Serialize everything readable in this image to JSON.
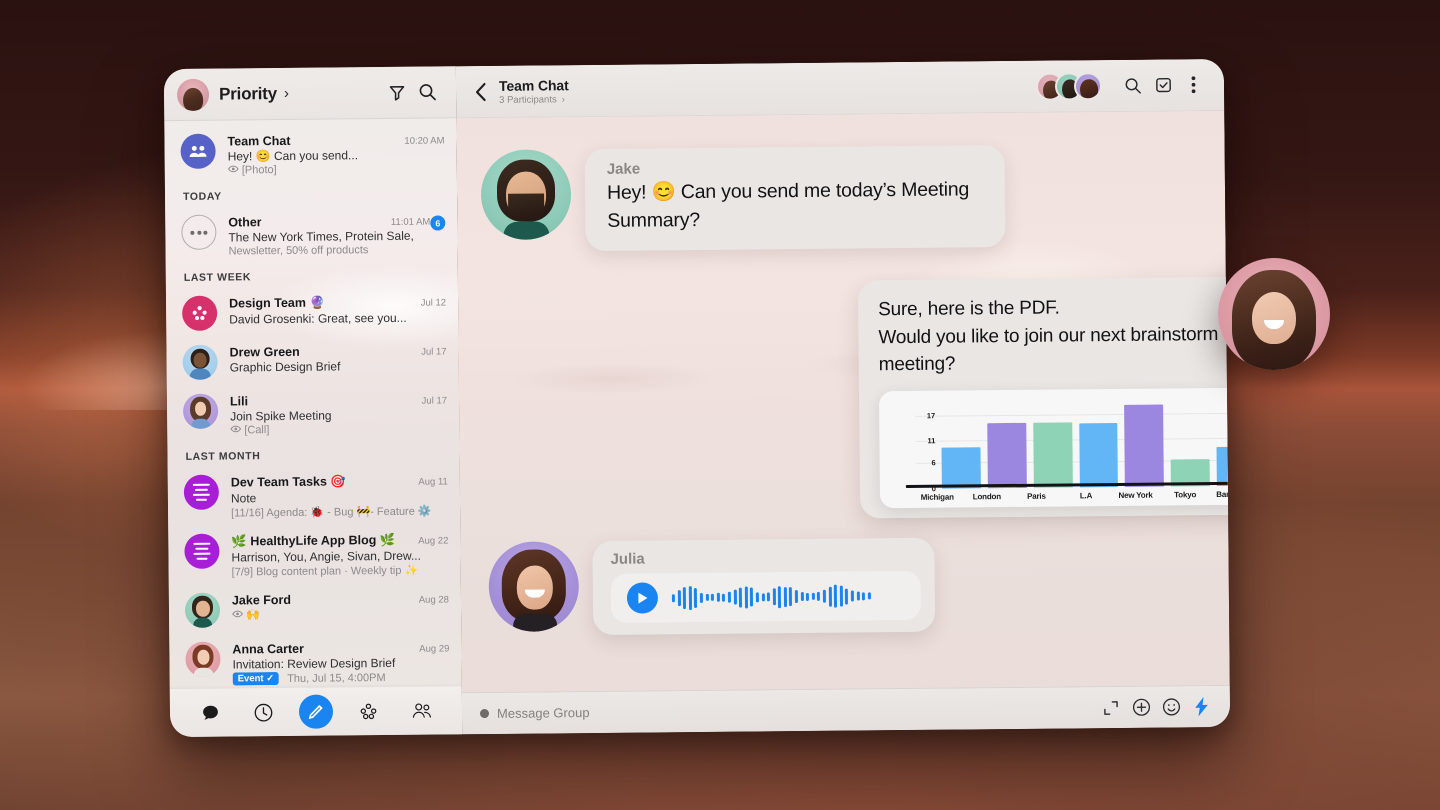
{
  "sidebar": {
    "header": {
      "title": "Priority",
      "chevron": "›",
      "filter_icon": "filter-icon",
      "search_icon": "search-icon"
    },
    "sections": [
      {
        "label": "",
        "items": [
          {
            "title": "Team Chat",
            "time": "10:20 AM",
            "sub": "Hey! 😊 Can you send...",
            "sub2": "[Photo]",
            "sub2_icon": "eye-icon",
            "avatar": "group-icon",
            "badge": ""
          }
        ]
      },
      {
        "label": "TODAY",
        "items": [
          {
            "title": "Other",
            "time": "11:01 AM",
            "sub": "The New York Times, Protein Sale,",
            "sub2": "Newsletter, 50% off products",
            "avatar": "ellipsis-icon",
            "badge": "6"
          }
        ]
      },
      {
        "label": "LAST WEEK",
        "items": [
          {
            "title": "Design Team 🔮",
            "time": "Jul 12",
            "sub": "David Grosenki: Great, see you...",
            "sub2": "",
            "avatar": "dots-cluster-icon",
            "badge": ""
          },
          {
            "title": "Drew Green",
            "time": "Jul 17",
            "sub": "Graphic Design Brief",
            "sub2": "",
            "avatar": "photo-drew",
            "badge": ""
          },
          {
            "title": "Lili",
            "time": "Jul 17",
            "sub": "Join Spike Meeting",
            "sub2": "[Call]",
            "sub2_icon": "eye-icon",
            "avatar": "photo-lili",
            "badge": ""
          }
        ]
      },
      {
        "label": "LAST MONTH",
        "items": [
          {
            "title": "Dev Team Tasks 🎯",
            "time": "Aug 11",
            "sub": "Note",
            "sub2": "[11/16] Agenda:  🐞 - Bug 🚧- Feature ⚙️",
            "avatar": "note-icon",
            "badge": ""
          },
          {
            "title": "🌿 HealthyLife App Blog 🌿",
            "time": "Aug 22",
            "sub": "Harrison, You, Angie, Sivan, Drew...",
            "sub2": "[7/9] Blog content plan · Weekly tip ✨",
            "avatar": "note-icon",
            "badge": ""
          },
          {
            "title": "Jake Ford",
            "time": "Aug 28",
            "sub2": "🙌",
            "sub": "",
            "sub2_icon": "eye-icon",
            "avatar": "photo-jake",
            "badge": ""
          },
          {
            "title": "Anna Carter",
            "time": "Aug 29",
            "sub": "Invitation: Review Design Brief",
            "chip": "Event ✓",
            "sub2": "Thu, Jul 15, 4:00PM",
            "avatar": "photo-anna",
            "badge": ""
          }
        ]
      }
    ],
    "nav": [
      {
        "name": "chats",
        "icon": "chat-bubble-icon",
        "active": true
      },
      {
        "name": "recent",
        "icon": "clock-icon",
        "active": false
      },
      {
        "name": "compose",
        "icon": "pencil-icon",
        "active": false
      },
      {
        "name": "groups",
        "icon": "dots-cluster-icon",
        "active": false
      },
      {
        "name": "contacts",
        "icon": "people-icon",
        "active": false
      }
    ]
  },
  "chat": {
    "back_icon": "chevron-left-icon",
    "title": "Team Chat",
    "subtitle": "3 Participants",
    "subtitle_chevron": "›",
    "header_icons": [
      {
        "name": "search-icon"
      },
      {
        "name": "inbox-check-icon"
      },
      {
        "name": "more-vertical-icon"
      }
    ],
    "messages": [
      {
        "type": "text",
        "sender": "Jake",
        "text": "Hey! 😊 Can you send me today’s Meeting Summary?",
        "avatar": "photo-jake"
      },
      {
        "type": "attachment",
        "text": "Sure, here is the PDF.\nWould you like to join our next brainstorm meeting?",
        "read_badge_icon": "eye-icon"
      },
      {
        "type": "voice",
        "sender": "Julia",
        "avatar": "photo-julia",
        "play_icon": "play-icon"
      }
    ],
    "composer": {
      "placeholder": "Message Group",
      "icons": [
        {
          "name": "expand-icon"
        },
        {
          "name": "plus-circle-icon"
        },
        {
          "name": "emoji-icon"
        },
        {
          "name": "lightning-icon"
        }
      ]
    }
  },
  "chart_data": {
    "type": "bar",
    "title": "",
    "xlabel": "",
    "ylabel": "",
    "categories": [
      "Michigan",
      "London",
      "Paris",
      "L.A",
      "New York",
      "Tokyo",
      "Barcelona"
    ],
    "values": [
      9.5,
      15,
      15,
      14.8,
      19,
      6.1,
      9
    ],
    "colors": [
      "#62b6f5",
      "#9b86e0",
      "#8ed3b5",
      "#62b6f5",
      "#9b86e0",
      "#8ed3b5",
      "#62b6f5"
    ],
    "yticks": [
      0,
      6,
      11,
      17
    ],
    "ylim": [
      0,
      20
    ],
    "grid": true,
    "legend": "none"
  },
  "colors": {
    "accent_blue": "#1a84f0",
    "read_green": "#14c234",
    "badge_blue": "#1a84f0",
    "bar_blue": "#62b6f5",
    "bar_purple": "#9b86e0",
    "bar_green": "#8ed3b5"
  }
}
